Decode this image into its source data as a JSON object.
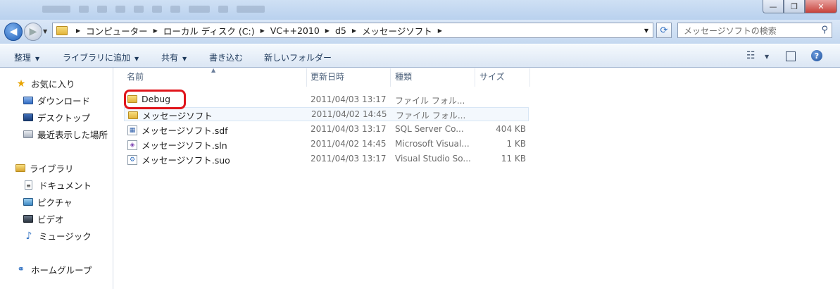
{
  "window": {
    "minimize_glyph": "—",
    "maximize_glyph": "❐",
    "close_glyph": "✕"
  },
  "nav": {
    "back_glyph": "◀",
    "forward_glyph": "▶",
    "dropdown_glyph": "▼",
    "breadcrumb": [
      "コンピューター",
      "ローカル ディスク (C:)",
      "VC++2010",
      "d5",
      "メッセージソフト"
    ],
    "refresh_glyph": "⟳"
  },
  "search": {
    "placeholder": "メッセージソフトの検索",
    "icon": "magnifier-icon"
  },
  "toolbar": {
    "organize": "整理",
    "add_to_library": "ライブラリに追加",
    "share": "共有",
    "burn": "書き込む",
    "new_folder": "新しいフォルダー",
    "dropdown_glyph": "▼",
    "view_glyph": "☷",
    "preview_glyph": "▯",
    "help_glyph": "?"
  },
  "sidebar": {
    "favorites": {
      "label": "お気に入り",
      "items": [
        "ダウンロード",
        "デスクトップ",
        "最近表示した場所"
      ]
    },
    "libraries": {
      "label": "ライブラリ",
      "items": [
        "ドキュメント",
        "ピクチャ",
        "ビデオ",
        "ミュージック"
      ]
    },
    "homegroup": "ホームグループ"
  },
  "columns": {
    "name": "名前",
    "date": "更新日時",
    "type": "種類",
    "size": "サイズ"
  },
  "files": [
    {
      "name": "Debug",
      "date": "2011/04/03 13:17",
      "type": "ファイル フォル...",
      "size": "",
      "icon": "folder-icon"
    },
    {
      "name": "メッセージソフト",
      "date": "2011/04/02 14:45",
      "type": "ファイル フォル...",
      "size": "",
      "icon": "folder-icon"
    },
    {
      "name": "メッセージソフト.sdf",
      "date": "2011/04/03 13:17",
      "type": "SQL Server Co...",
      "size": "404 KB",
      "icon": "sdf-file-icon"
    },
    {
      "name": "メッセージソフト.sln",
      "date": "2011/04/02 14:45",
      "type": "Microsoft Visual...",
      "size": "1 KB",
      "icon": "sln-file-icon"
    },
    {
      "name": "メッセージソフト.suo",
      "date": "2011/04/03 13:17",
      "type": "Visual Studio So...",
      "size": "11 KB",
      "icon": "suo-file-icon"
    }
  ],
  "colors": {
    "highlight_circle": "#e0151b",
    "toolbar_text": "#1e395b"
  }
}
